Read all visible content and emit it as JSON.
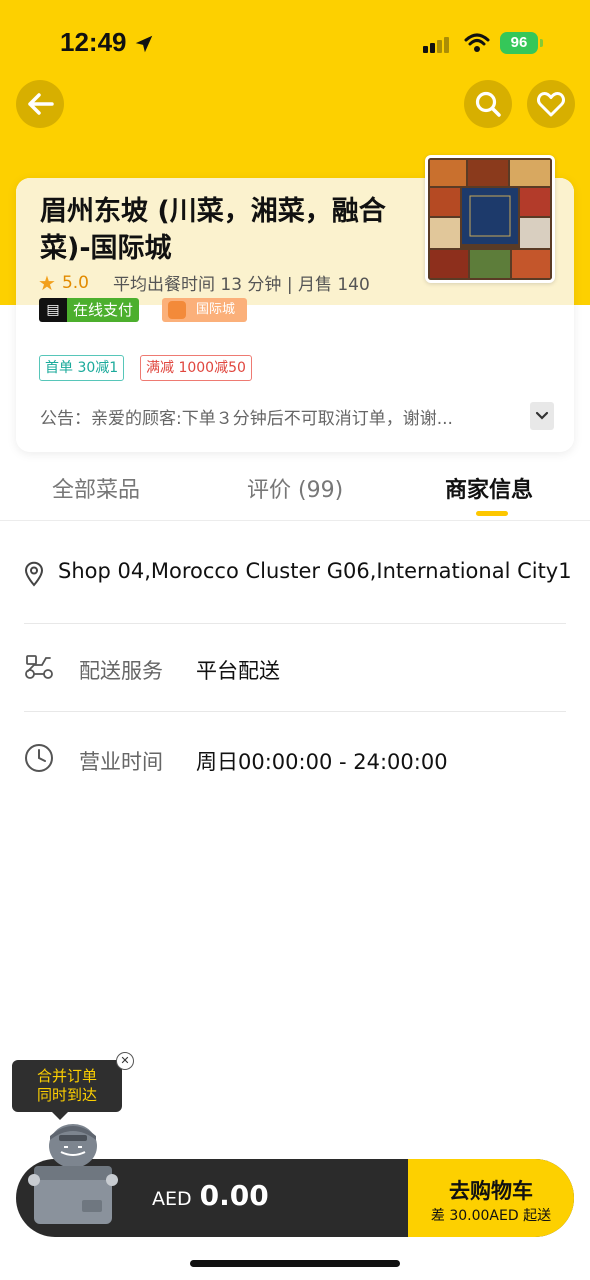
{
  "status_bar": {
    "time": "12:49",
    "battery": "96"
  },
  "shop": {
    "name": "眉州东坡 (川菜，湘菜，融合菜)-国际城",
    "rating": "5.0",
    "stats": "平均出餐时间 13 分钟 | 月售 140",
    "tags": {
      "online_pay": "在线支付",
      "area": "国际城"
    },
    "promotions": {
      "first_order": "首单 30减1",
      "full_reduction": "满减 1000减50"
    },
    "notice": "公告：亲爱的顾客:下单３分钟后不可取消订单，谢谢..."
  },
  "tabs": [
    {
      "label": "全部菜品"
    },
    {
      "label": "评价 (99)"
    },
    {
      "label": "商家信息"
    }
  ],
  "active_tab": "商家信息",
  "info": {
    "address": "Shop 04,Morocco Cluster G06,International City1",
    "delivery_label": "配送服务",
    "delivery_value": "平台配送",
    "hours_label": "营业时间",
    "hours_value": "周日00:00:00 - 24:00:00"
  },
  "merge_tip": {
    "line1": "合并订单",
    "line2": "同时到达"
  },
  "cart": {
    "currency": "AED",
    "total": "0.00",
    "checkout_label": "去购物车",
    "checkout_sub": "差 30.00AED 起送"
  },
  "colors": {
    "brand_yellow": "#FDD000",
    "cart_dark": "#2B2B2B",
    "online_green": "#4CAF2D"
  }
}
